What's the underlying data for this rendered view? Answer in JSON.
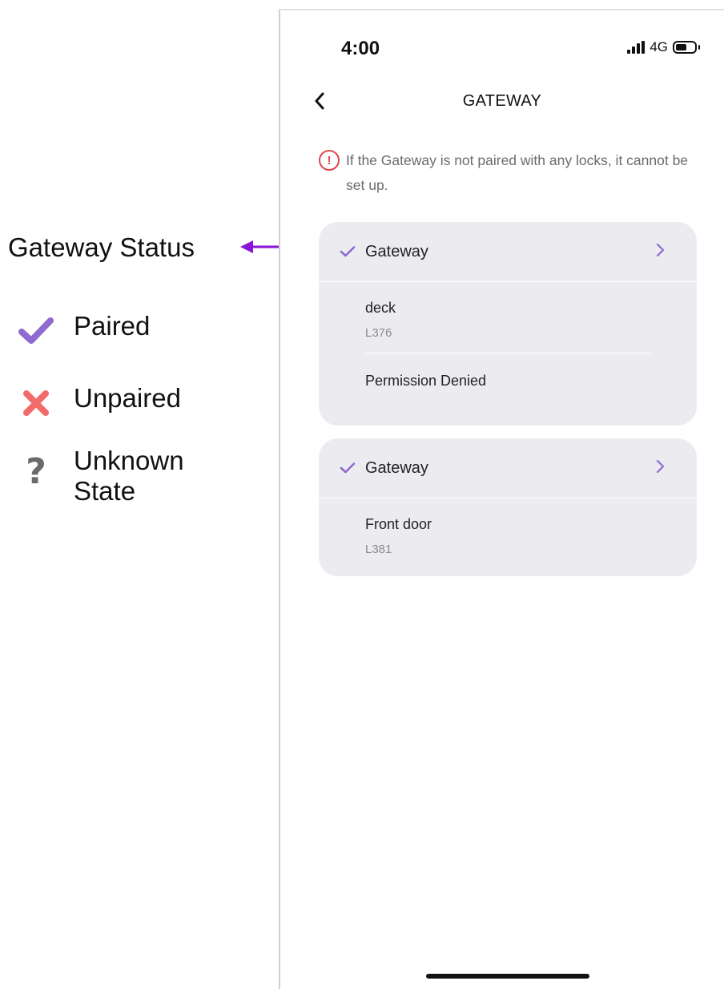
{
  "legend": {
    "title": "Gateway Status",
    "items": [
      {
        "icon": "check-icon",
        "label": "Paired",
        "color": "#8e6ad1"
      },
      {
        "icon": "x-icon",
        "label": "Unpaired",
        "color": "#f26b6b"
      },
      {
        "icon": "question-icon",
        "label": "Unknown State",
        "color": "#6a6a6a"
      }
    ],
    "arrow_color": "#8a15d6"
  },
  "status_bar": {
    "time": "4:00",
    "network": "4G"
  },
  "nav": {
    "title": "GATEWAY"
  },
  "notice": {
    "icon": "warning-icon",
    "text": "If the Gateway is not paired with any locks, it cannot be set up.",
    "color": "#e0474c"
  },
  "gateways": [
    {
      "label": "Gateway",
      "status": "paired",
      "locks": [
        {
          "name": "deck",
          "id": "L376"
        }
      ],
      "extra": "Permission Denied"
    },
    {
      "label": "Gateway",
      "status": "paired",
      "locks": [
        {
          "name": "Front door",
          "id": "L381"
        }
      ]
    }
  ],
  "colors": {
    "accent": "#8e6ad1",
    "card_bg": "#ececf0"
  }
}
